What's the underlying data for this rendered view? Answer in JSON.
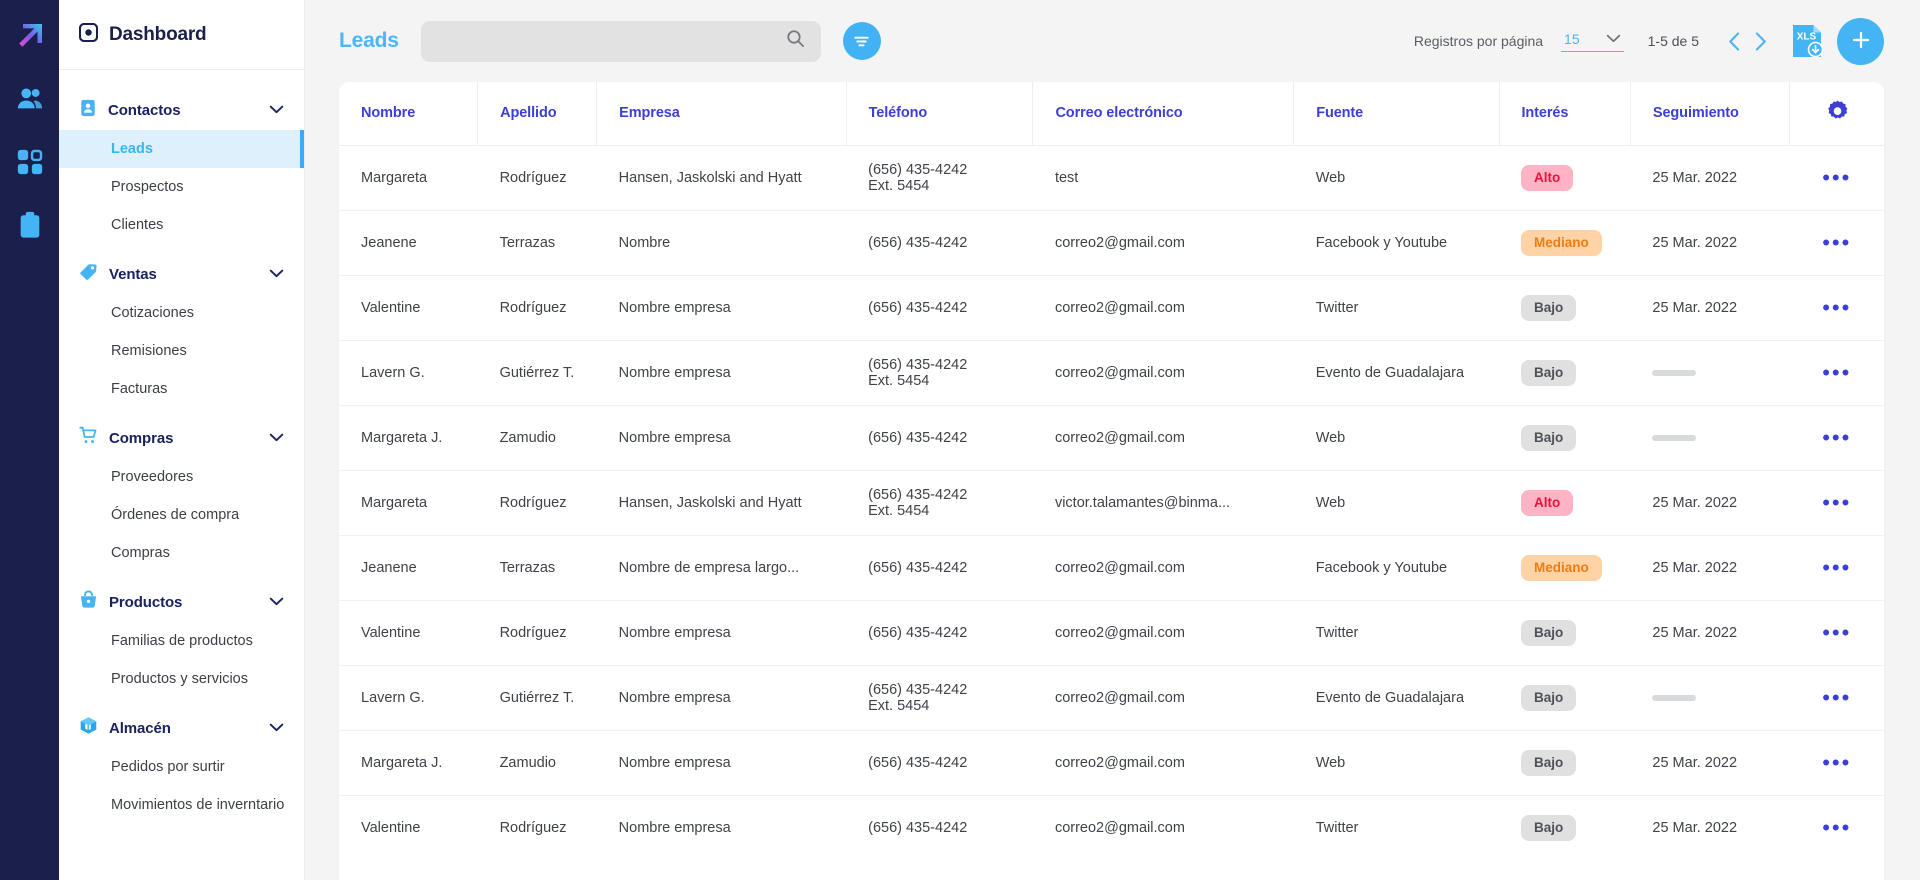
{
  "rail": {
    "items": [
      {
        "icon": "logo-arrow-icon"
      },
      {
        "icon": "users-icon"
      },
      {
        "icon": "grid-apps-icon"
      },
      {
        "icon": "clipboard-icon"
      }
    ]
  },
  "sidebar": {
    "header": {
      "title": "Dashboard",
      "icon": "dashboard-icon"
    },
    "groups": [
      {
        "label": "Contactos",
        "icon": "contacts-icon",
        "chevron": "chevron-down-icon",
        "items": [
          {
            "label": "Leads",
            "active": true
          },
          {
            "label": "Prospectos",
            "active": false
          },
          {
            "label": "Clientes",
            "active": false
          }
        ]
      },
      {
        "label": "Ventas",
        "icon": "tag-icon",
        "chevron": "chevron-down-icon",
        "items": [
          {
            "label": "Cotizaciones",
            "active": false
          },
          {
            "label": "Remisiones",
            "active": false
          },
          {
            "label": "Facturas",
            "active": false
          }
        ]
      },
      {
        "label": "Compras",
        "icon": "cart-icon",
        "chevron": "chevron-down-icon",
        "items": [
          {
            "label": "Proveedores",
            "active": false
          },
          {
            "label": "Órdenes de compra",
            "active": false
          },
          {
            "label": "Compras",
            "active": false
          }
        ]
      },
      {
        "label": "Productos",
        "icon": "basket-icon",
        "chevron": "chevron-down-icon",
        "items": [
          {
            "label": "Familias de productos",
            "active": false
          },
          {
            "label": "Productos y servicios",
            "active": false
          }
        ]
      },
      {
        "label": "Almacén",
        "icon": "box-icon",
        "chevron": "chevron-down-icon",
        "items": [
          {
            "label": "Pedidos por surtir",
            "active": false
          },
          {
            "label": "Movimientos de inverntario",
            "active": false
          }
        ]
      }
    ]
  },
  "toolbar": {
    "page_title": "Leads",
    "search": {
      "value": "",
      "placeholder": "",
      "icon": "search-icon"
    },
    "filter_button": {
      "icon": "filter-icon"
    },
    "records_per_page_label": "Registros por página",
    "records_per_page_value": "15",
    "records_per_page_chevron": "chevron-down-icon",
    "range_text": "1-5 de 5",
    "prev_icon": "chevron-left-icon",
    "next_icon": "chevron-right-icon",
    "export_button": {
      "label": "XLS",
      "icon": "xls-download-icon"
    },
    "add_button": {
      "icon": "plus-icon"
    }
  },
  "table": {
    "settings_icon": "gear-icon",
    "row_menu_icon": "ellipsis-icon",
    "columns": [
      "Nombre",
      "Apellido",
      "Empresa",
      "Teléfono",
      "Correo electrónico",
      "Fuente",
      "Interés",
      "Seguimiento"
    ],
    "rows": [
      {
        "nombre": "Margareta",
        "apellido": "Rodríguez",
        "empresa": "Hansen, Jaskolski and Hyatt",
        "telefono": "(656) 435-4242",
        "telefono_ext": "Ext. 5454",
        "correo": "test",
        "fuente": "Web",
        "interes": "Alto",
        "interes_level": "alto",
        "seguimiento": "25 Mar. 2022"
      },
      {
        "nombre": "Jeanene",
        "apellido": "Terrazas",
        "empresa": "Nombre",
        "telefono": "(656) 435-4242",
        "telefono_ext": "",
        "correo": "correo2@gmail.com",
        "fuente": "Facebook y Youtube",
        "interes": "Mediano",
        "interes_level": "mediano",
        "seguimiento": "25 Mar. 2022"
      },
      {
        "nombre": "Valentine",
        "apellido": "Rodríguez",
        "empresa": "Nombre empresa",
        "telefono": "(656) 435-4242",
        "telefono_ext": "",
        "correo": "correo2@gmail.com",
        "fuente": "Twitter",
        "interes": "Bajo",
        "interes_level": "bajo",
        "seguimiento": "25 Mar. 2022"
      },
      {
        "nombre": "Lavern G.",
        "apellido": "Gutiérrez T.",
        "empresa": "Nombre empresa",
        "telefono": "(656) 435-4242",
        "telefono_ext": "Ext. 5454",
        "correo": "correo2@gmail.com",
        "fuente": "Evento de Guadalajara",
        "interes": "Bajo",
        "interes_level": "bajo",
        "seguimiento": ""
      },
      {
        "nombre": "Margareta J.",
        "apellido": "Zamudio",
        "empresa": "Nombre empresa",
        "telefono": "(656) 435-4242",
        "telefono_ext": "",
        "correo": "correo2@gmail.com",
        "fuente": "Web",
        "interes": "Bajo",
        "interes_level": "bajo",
        "seguimiento": ""
      },
      {
        "nombre": "Margareta",
        "apellido": "Rodríguez",
        "empresa": "Hansen, Jaskolski and Hyatt",
        "telefono": "(656) 435-4242",
        "telefono_ext": "Ext. 5454",
        "correo": "victor.talamantes@binma...",
        "fuente": "Web",
        "interes": "Alto",
        "interes_level": "alto",
        "seguimiento": "25 Mar. 2022"
      },
      {
        "nombre": "Jeanene",
        "apellido": "Terrazas",
        "empresa": "Nombre de empresa largo...",
        "telefono": "(656) 435-4242",
        "telefono_ext": "",
        "correo": "correo2@gmail.com",
        "fuente": "Facebook y Youtube",
        "interes": "Mediano",
        "interes_level": "mediano",
        "seguimiento": "25 Mar. 2022"
      },
      {
        "nombre": "Valentine",
        "apellido": "Rodríguez",
        "empresa": "Nombre empresa",
        "telefono": "(656) 435-4242",
        "telefono_ext": "",
        "correo": "correo2@gmail.com",
        "fuente": "Twitter",
        "interes": "Bajo",
        "interes_level": "bajo",
        "seguimiento": "25 Mar. 2022"
      },
      {
        "nombre": "Lavern G.",
        "apellido": "Gutiérrez T.",
        "empresa": "Nombre empresa",
        "telefono": "(656) 435-4242",
        "telefono_ext": "Ext. 5454",
        "correo": "correo2@gmail.com",
        "fuente": "Evento de Guadalajara",
        "interes": "Bajo",
        "interes_level": "bajo",
        "seguimiento": ""
      },
      {
        "nombre": "Margareta J.",
        "apellido": "Zamudio",
        "empresa": "Nombre empresa",
        "telefono": "(656) 435-4242",
        "telefono_ext": "",
        "correo": "correo2@gmail.com",
        "fuente": "Web",
        "interes": "Bajo",
        "interes_level": "bajo",
        "seguimiento": "25 Mar. 2022"
      },
      {
        "nombre": "Valentine",
        "apellido": "Rodríguez",
        "empresa": "Nombre empresa",
        "telefono": "(656) 435-4242",
        "telefono_ext": "",
        "correo": "correo2@gmail.com",
        "fuente": "Twitter",
        "interes": "Bajo",
        "interes_level": "bajo",
        "seguimiento": "25 Mar. 2022"
      }
    ]
  },
  "colors": {
    "rail_bg": "#1b1f4b",
    "accent_blue": "#45b4f4",
    "header_blue": "#3b3fd6",
    "active_item_bg": "#ddf0fb",
    "badge_alto_bg": "#ffb3c4",
    "badge_alto_fg": "#e8123c",
    "badge_mediano_bg": "#ffd3a5",
    "badge_mediano_fg": "#f07b10",
    "badge_bajo_bg": "#e0e0e0",
    "badge_bajo_fg": "#4e5157"
  }
}
